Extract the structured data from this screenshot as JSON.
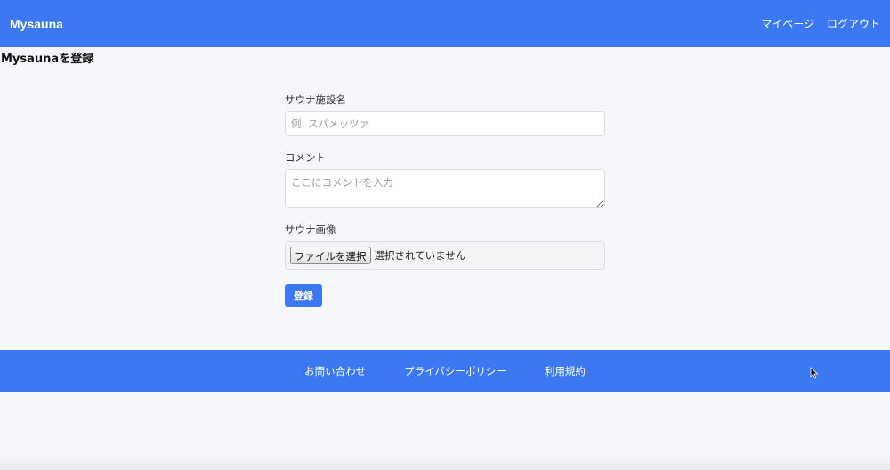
{
  "navbar": {
    "brand": "Mysauna",
    "links": [
      "マイページ",
      "ログアウト"
    ]
  },
  "page": {
    "title": "Mysaunaを登録"
  },
  "form": {
    "name_label": "サウナ施設名",
    "name_placeholder": "例: スパメッツァ",
    "comment_label": "コメント",
    "comment_placeholder": "ここにコメントを入力",
    "image_label": "サウナ画像",
    "file_button": "ファイルを選択",
    "file_status": "選択されていません",
    "submit": "登録"
  },
  "footer": {
    "links": [
      "お問い合わせ",
      "プライバシーポリシー",
      "利用規約"
    ]
  },
  "colors": {
    "primary": "#3b78f2",
    "background": "#f5f7fb"
  }
}
